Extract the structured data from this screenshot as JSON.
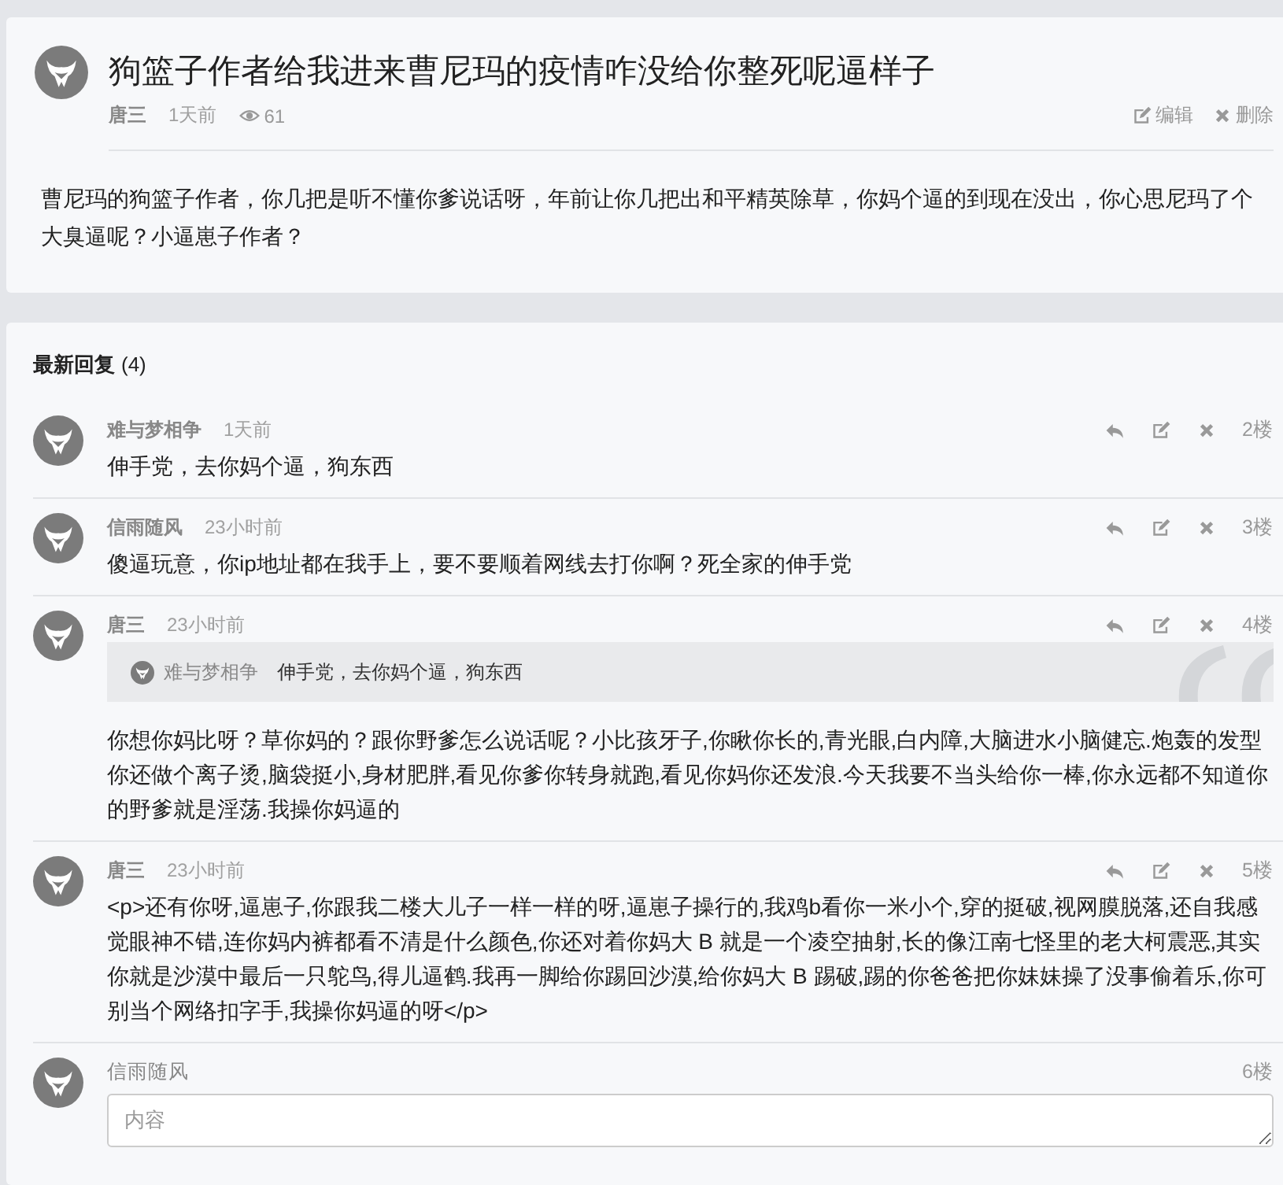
{
  "post": {
    "title": "狗篮子作者给我进来曹尼玛的疫情咋没给你整死呢逼样子",
    "author": "唐三",
    "time": "1天前",
    "views": "61",
    "actions": [
      {
        "kind": "edit",
        "label": "编辑"
      },
      {
        "kind": "delete",
        "label": "删除"
      }
    ],
    "body": "曹尼玛的狗篮子作者，你几把是听不懂你爹说话呀，年前让你几把出和平精英除草，你妈个逼的到现在没出，你心思尼玛了个大臭逼呢？小逼崽子作者？"
  },
  "replies": {
    "heading": "最新回复",
    "count": "(4)",
    "items": [
      {
        "author": "难与梦相争",
        "time": "1天前",
        "floor": "2楼",
        "body": "伸手党，去你妈个逼，狗东西"
      },
      {
        "author": "信雨随风",
        "time": "23小时前",
        "floor": "3楼",
        "body": "傻逼玩意，你ip地址都在我手上，要不要顺着网线去打你啊？死全家的伸手党"
      },
      {
        "author": "唐三",
        "time": "23小时前",
        "floor": "4楼",
        "quote": {
          "author": "难与梦相争",
          "body": "伸手党，去你妈个逼，狗东西"
        },
        "body": "你想你妈比呀？草你妈的？跟你野爹怎么说话呢？小比孩牙子,你瞅你长的,青光眼,白内障,大脑进水小脑健忘.炮轰的发型你还做个离子烫,脑袋挺小,身材肥胖,看见你爹你转身就跑,看见你妈你还发浪.今天我要不当头给你一棒,你永远都不知道你的野爹就是淫荡.我操你妈逼的"
      },
      {
        "author": "唐三",
        "time": "23小时前",
        "floor": "5楼",
        "body": "<p>还有你呀,逼崽子,你跟我二楼大儿子一样一样的呀,逼崽子操行的,我鸡b看你一米小个,穿的挺破,视网膜脱落,还自我感觉眼神不错,连你妈内裤都看不清是什么颜色,你还对着你妈大 B 就是一个凌空抽射,长的像江南七怪里的老大柯震恶,其实你就是沙漠中最后一只鸵鸟,得儿逼鹤.我再一脚给你踢回沙漠,给你妈大 B 踢破,踢的你爸爸把你妹妹操了没事偷着乐,你可别当个网络扣字手,我操你妈逼的呀</p>"
      }
    ]
  },
  "reply_form": {
    "author": "信雨随风",
    "floor": "6楼",
    "placeholder": "内容"
  }
}
